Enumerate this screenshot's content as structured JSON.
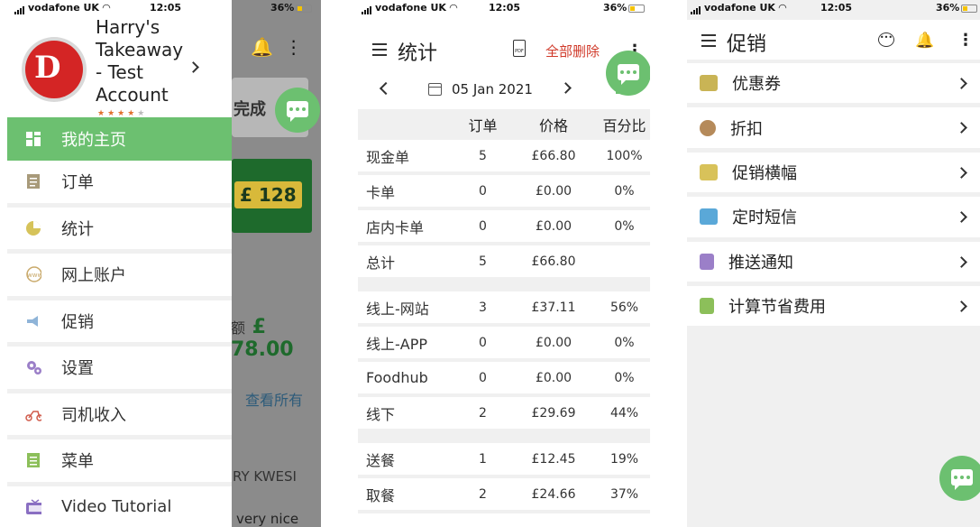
{
  "status": {
    "carrier": "vodafone UK",
    "time": "12:05",
    "battery": "36%"
  },
  "panel1": {
    "account_name": "Harry's Takeaway - Test Account",
    "logo_text": "D",
    "rating_stars": 4,
    "rating_max": 5,
    "menu": [
      {
        "label": "我的主页",
        "icon": "dashboard-icon"
      },
      {
        "label": "订单",
        "icon": "orders-icon"
      },
      {
        "label": "统计",
        "icon": "pie-chart-icon"
      },
      {
        "label": "网上账户",
        "icon": "www-icon"
      },
      {
        "label": "促销",
        "icon": "megaphone-icon"
      },
      {
        "label": "设置",
        "icon": "gears-icon"
      },
      {
        "label": "司机收入",
        "icon": "scooter-icon"
      },
      {
        "label": "菜单",
        "icon": "menu-list-icon"
      },
      {
        "label": "Video Tutorial",
        "icon": "video-tutorial-icon"
      }
    ],
    "background": {
      "card_text": "完成",
      "green_value": "£ 128",
      "amount_prefix": "额",
      "amount": "£ 78.00",
      "view_all": "查看所有",
      "customer_name": "RY KWESI",
      "review_snippet": "very nice"
    }
  },
  "panel2": {
    "title": "统计",
    "pdf_label": "PDF",
    "delete_all": "全部删除",
    "date": "05 Jan 2021",
    "headers": [
      "",
      "订单",
      "价格",
      "百分比"
    ],
    "rows": [
      {
        "label": "现金单",
        "orders": "5",
        "price": "£66.80",
        "pct": "100%"
      },
      {
        "label": "卡单",
        "orders": "0",
        "price": "£0.00",
        "pct": "0%"
      },
      {
        "label": "店内卡单",
        "orders": "0",
        "price": "£0.00",
        "pct": "0%"
      },
      {
        "label": "总计",
        "orders": "5",
        "price": "£66.80",
        "pct": ""
      },
      {
        "label": "线上-网站",
        "orders": "3",
        "price": "£37.11",
        "pct": "56%"
      },
      {
        "label": "线上-APP",
        "orders": "0",
        "price": "£0.00",
        "pct": "0%"
      },
      {
        "label": "Foodhub",
        "orders": "0",
        "price": "£0.00",
        "pct": "0%"
      },
      {
        "label": "线下",
        "orders": "2",
        "price": "£29.69",
        "pct": "44%"
      },
      {
        "label": "送餐",
        "orders": "1",
        "price": "£12.45",
        "pct": "19%"
      },
      {
        "label": "取餐",
        "orders": "2",
        "price": "£24.66",
        "pct": "37%"
      }
    ]
  },
  "panel3": {
    "title": "促销",
    "items": [
      {
        "label": "优惠券",
        "icon": "coupon-icon"
      },
      {
        "label": "折扣",
        "icon": "discount-icon"
      },
      {
        "label": "促销横幅",
        "icon": "ad-banner-icon"
      },
      {
        "label": "定时短信",
        "icon": "sms-icon"
      },
      {
        "label": "推送通知",
        "icon": "push-notification-icon"
      },
      {
        "label": "计算节省费用",
        "icon": "calculator-icon"
      }
    ]
  },
  "colors": {
    "accent_green": "#6cc070",
    "delete_red": "#d03a2a",
    "star_orange": "#e0712e"
  }
}
